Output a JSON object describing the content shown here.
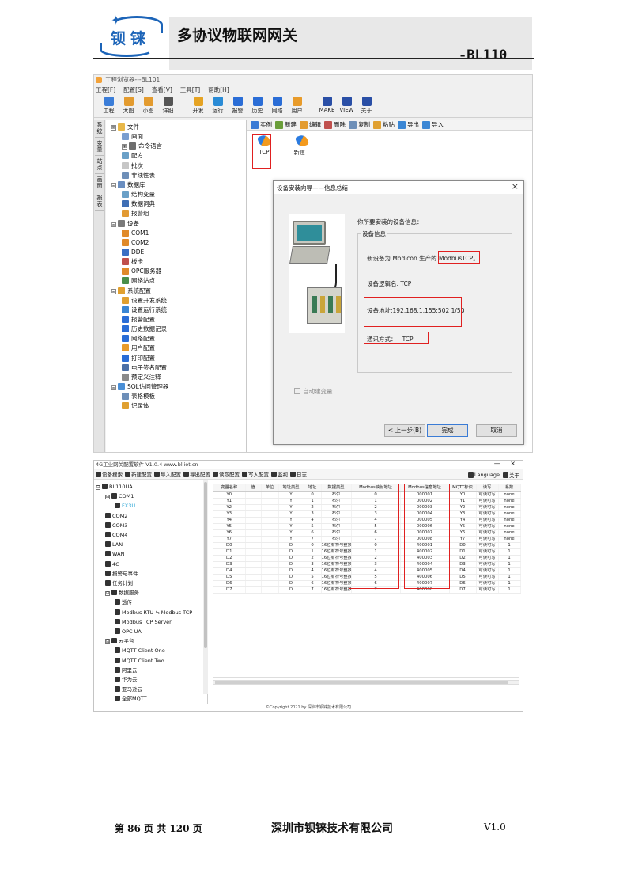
{
  "header": {
    "logo_text": "钡铼",
    "title": "多协议物联网网关",
    "model": "-BL110"
  },
  "shot1": {
    "window_title": "工程浏览器---BL101",
    "menu": [
      "工程[F]",
      "配置[S]",
      "查看[V]",
      "工具[T]",
      "帮助[H]"
    ],
    "toolbar": [
      {
        "label": "工程",
        "icon": "tools-icon",
        "color": "#3b7dd8"
      },
      {
        "label": "大图",
        "icon": "large-icon",
        "color": "#e39b2f"
      },
      {
        "label": "小图",
        "icon": "small-icon",
        "color": "#e39b2f"
      },
      {
        "label": "详细",
        "icon": "detail-icon",
        "color": "#555555"
      },
      {
        "label": "开发",
        "icon": "develop-icon",
        "color": "#e5a323"
      },
      {
        "label": "运行",
        "icon": "run-icon",
        "color": "#2a8bd6"
      },
      {
        "label": "报警",
        "icon": "alarm-icon",
        "color": "#2a6dd6"
      },
      {
        "label": "历史",
        "icon": "history-icon",
        "color": "#2a6dd6"
      },
      {
        "label": "网络",
        "icon": "network-icon",
        "color": "#2a6dd6"
      },
      {
        "label": "用户",
        "icon": "user-icon",
        "color": "#e89b2a"
      },
      {
        "label": "MAKE",
        "icon": "make-icon",
        "color": "#2a4fa6"
      },
      {
        "label": "VIEW",
        "icon": "view-icon",
        "color": "#2a4fa6"
      },
      {
        "label": "关于",
        "icon": "about-icon",
        "color": "#2a4fa6"
      }
    ],
    "side_tabs": [
      "系统",
      "变量",
      "站点",
      "画面",
      "报表"
    ],
    "tree": [
      {
        "label": "文件",
        "level": 0,
        "expander": "⊟",
        "color": "#e8b84a"
      },
      {
        "label": "画面",
        "level": 1,
        "color": "#7a9ecf"
      },
      {
        "label": "命令语言",
        "level": 1,
        "expander": "⊞",
        "color": "#6e6e6e"
      },
      {
        "label": "配方",
        "level": 1,
        "color": "#6aa0c7"
      },
      {
        "label": "批次",
        "level": 1,
        "color": "#c6c6c6"
      },
      {
        "label": "非线性表",
        "level": 1,
        "color": "#6e8fb8"
      },
      {
        "label": "数据库",
        "level": 0,
        "expander": "⊟",
        "color": "#6a8ec0"
      },
      {
        "label": "结构变量",
        "level": 1,
        "color": "#6aa0c7"
      },
      {
        "label": "数据词典",
        "level": 1,
        "color": "#3f6fb5"
      },
      {
        "label": "报警组",
        "level": 1,
        "color": "#e29a33"
      },
      {
        "label": "设备",
        "level": 0,
        "expander": "⊟",
        "color": "#7a7a7a"
      },
      {
        "label": "COM1",
        "level": 1,
        "color": "#e08a2a"
      },
      {
        "label": "COM2",
        "level": 1,
        "color": "#e08a2a"
      },
      {
        "label": "DDE",
        "level": 1,
        "color": "#3a6fc4"
      },
      {
        "label": "板卡",
        "level": 1,
        "color": "#c0504d"
      },
      {
        "label": "OPC服务器",
        "level": 1,
        "color": "#e08a2a"
      },
      {
        "label": "网络站点",
        "level": 1,
        "color": "#4a8f4a"
      },
      {
        "label": "系统配置",
        "level": 0,
        "expander": "⊟",
        "color": "#e0a030"
      },
      {
        "label": "设置开发系统",
        "level": 1,
        "color": "#e0a030"
      },
      {
        "label": "设置运行系统",
        "level": 1,
        "color": "#3a86d4"
      },
      {
        "label": "报警配置",
        "level": 1,
        "color": "#2a6dd6"
      },
      {
        "label": "历史数据记录",
        "level": 1,
        "color": "#2a6dd6"
      },
      {
        "label": "网络配置",
        "level": 1,
        "color": "#2a6dd6"
      },
      {
        "label": "用户配置",
        "level": 1,
        "color": "#e89b2a"
      },
      {
        "label": "打印配置",
        "level": 1,
        "color": "#2a6dd6"
      },
      {
        "label": "电子签名配置",
        "level": 1,
        "color": "#4a6fa6"
      },
      {
        "label": "预定义注释",
        "level": 1,
        "color": "#8a8a8a"
      },
      {
        "label": "SQL访问管理器",
        "level": 0,
        "expander": "⊟",
        "color": "#4a8fd6"
      },
      {
        "label": "表格模板",
        "level": 1,
        "color": "#6e8fb8"
      },
      {
        "label": "记录体",
        "level": 1,
        "color": "#e0a030"
      }
    ],
    "right_toolbar": [
      "实例",
      "新建",
      "编辑",
      "删除",
      "复制",
      "粘贴",
      "导出",
      "导入"
    ],
    "devices": [
      "TCP",
      "新建..."
    ],
    "dialog": {
      "title": "设备安装向导——信息总结",
      "close": "×",
      "hint": "你所要安装的设备信息：",
      "group_label": "设备信息",
      "line1_prefix": "新设备为 Modicon 生产的",
      "line1_value": "ModbusTCP",
      "line1_suffix": "。",
      "line2": "设备逻辑名: TCP",
      "line3": "设备地址:192.168.1.155:502 1/50",
      "line4_label": "通讯方式：",
      "line4_value": "TCP",
      "checkbox": "自动建变量",
      "btn_back": "< 上一步(B)",
      "btn_finish": "完成",
      "btn_cancel": "取消"
    }
  },
  "shot2": {
    "window_title": "4G工业网关配置软件 V1.0.4 www.bliiot.cn",
    "window_controls": "— ×",
    "toolbar": [
      "设备搜索",
      "新建配置",
      "导入配置",
      "导出配置",
      "读取配置",
      "写入配置",
      "监视",
      "日志"
    ],
    "toolbar_right": [
      "Language",
      "关于"
    ],
    "tree": [
      {
        "label": "BL110UA",
        "level": 0,
        "expander": "⊟"
      },
      {
        "label": "COM1",
        "level": 1,
        "expander": "⊟"
      },
      {
        "label": "FX3U",
        "level": 2,
        "color": "#2aa6d6"
      },
      {
        "label": "COM2",
        "level": 1
      },
      {
        "label": "COM3",
        "level": 1
      },
      {
        "label": "COM4",
        "level": 1
      },
      {
        "label": "LAN",
        "level": 1
      },
      {
        "label": "WAN",
        "level": 1
      },
      {
        "label": "4G",
        "level": 1
      },
      {
        "label": "报警与事件",
        "level": 1
      },
      {
        "label": "任务计划",
        "level": 1
      },
      {
        "label": "数据服务",
        "level": 1,
        "expander": "⊟"
      },
      {
        "label": "透传",
        "level": 2
      },
      {
        "label": "Modbus RTU ≒ Modbus TCP",
        "level": 2
      },
      {
        "label": "Modbus TCP Server",
        "level": 2
      },
      {
        "label": "OPC UA",
        "level": 2
      },
      {
        "label": "云平台",
        "level": 1,
        "expander": "⊟"
      },
      {
        "label": "MQTT Client One",
        "level": 2
      },
      {
        "label": "MQTT Client Two",
        "level": 2
      },
      {
        "label": "阿里云",
        "level": 2
      },
      {
        "label": "华为云",
        "level": 2
      },
      {
        "label": "亚马逊云",
        "level": 2
      },
      {
        "label": "全部MQTT",
        "level": 2
      }
    ],
    "columns": [
      "变量名称",
      "值",
      "单位",
      "地址类型",
      "地址",
      "数据类型",
      "Modbus映射地址",
      "Modbus信息地址",
      "MQTT标识",
      "读写",
      "系数"
    ],
    "rows": [
      [
        "Y0",
        "",
        "",
        "Y",
        "0",
        "布尔",
        "0",
        "000001",
        "Y0",
        "可读可写",
        "none"
      ],
      [
        "Y1",
        "",
        "",
        "Y",
        "1",
        "布尔",
        "1",
        "000002",
        "Y1",
        "可读可写",
        "none"
      ],
      [
        "Y2",
        "",
        "",
        "Y",
        "2",
        "布尔",
        "2",
        "000003",
        "Y2",
        "可读可写",
        "none"
      ],
      [
        "Y3",
        "",
        "",
        "Y",
        "3",
        "布尔",
        "3",
        "000004",
        "Y3",
        "可读可写",
        "none"
      ],
      [
        "Y4",
        "",
        "",
        "Y",
        "4",
        "布尔",
        "4",
        "000005",
        "Y4",
        "可读可写",
        "none"
      ],
      [
        "Y5",
        "",
        "",
        "Y",
        "5",
        "布尔",
        "5",
        "000006",
        "Y5",
        "可读可写",
        "none"
      ],
      [
        "Y6",
        "",
        "",
        "Y",
        "6",
        "布尔",
        "6",
        "000007",
        "Y6",
        "可读可写",
        "none"
      ],
      [
        "Y7",
        "",
        "",
        "Y",
        "7",
        "布尔",
        "7",
        "000008",
        "Y7",
        "可读可写",
        "none"
      ],
      [
        "D0",
        "",
        "",
        "D",
        "0",
        "16位有符号整数",
        "0",
        "400001",
        "D0",
        "可读可写",
        "1"
      ],
      [
        "D1",
        "",
        "",
        "D",
        "1",
        "16位有符号整数",
        "1",
        "400002",
        "D1",
        "可读可写",
        "1"
      ],
      [
        "D2",
        "",
        "",
        "D",
        "2",
        "16位有符号整数",
        "2",
        "400003",
        "D2",
        "可读可写",
        "1"
      ],
      [
        "D3",
        "",
        "",
        "D",
        "3",
        "16位有符号整数",
        "3",
        "400004",
        "D3",
        "可读可写",
        "1"
      ],
      [
        "D4",
        "",
        "",
        "D",
        "4",
        "16位有符号整数",
        "4",
        "400005",
        "D4",
        "可读可写",
        "1"
      ],
      [
        "D5",
        "",
        "",
        "D",
        "5",
        "16位有符号整数",
        "5",
        "400006",
        "D5",
        "可读可写",
        "1"
      ],
      [
        "D6",
        "",
        "",
        "D",
        "6",
        "16位有符号整数",
        "6",
        "400007",
        "D6",
        "可读可写",
        "1"
      ],
      [
        "D7",
        "",
        "",
        "D",
        "7",
        "16位有符号整数",
        "7",
        "400008",
        "D7",
        "可读可写",
        "1"
      ]
    ],
    "copyright": "©Copyright 2021 by 深圳市钡铼技术有限公司"
  },
  "footer": {
    "page": "第 86 页 共 120 页",
    "company": "深圳市钡铼技术有限公司",
    "version": "V1.0"
  }
}
